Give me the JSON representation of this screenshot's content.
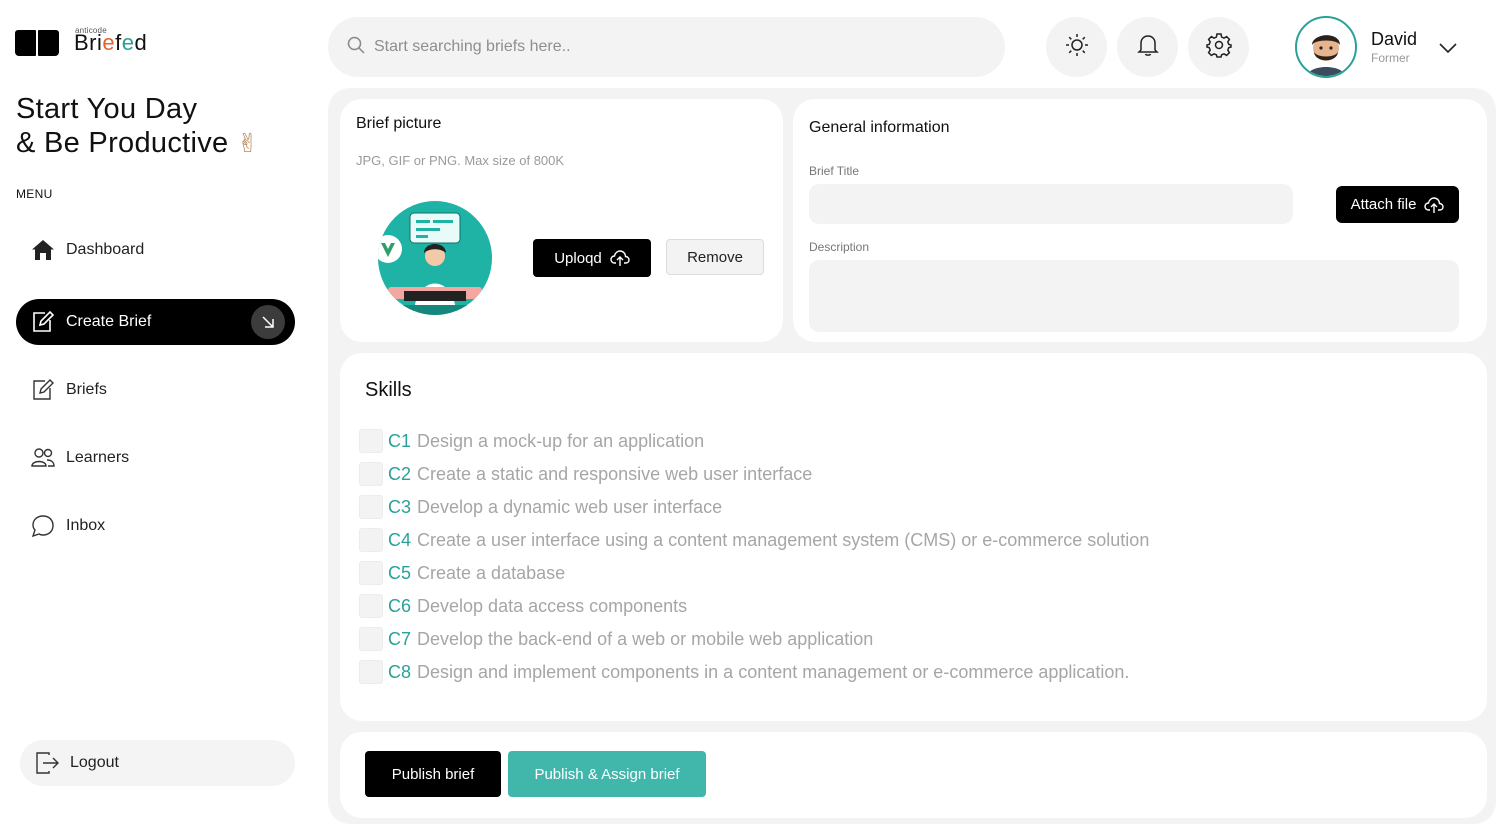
{
  "brand": {
    "small_text": "anticode",
    "name_parts": [
      "Bri",
      "e",
      "f",
      "e",
      "d"
    ]
  },
  "greeting": {
    "line1": "Start You Day",
    "line2": "& Be Productive",
    "emoji": "✌"
  },
  "menu": {
    "label": "MENU",
    "items": [
      {
        "label": "Dashboard",
        "icon": "home-icon"
      },
      {
        "label": "Create Brief",
        "icon": "edit-icon",
        "active": true
      },
      {
        "label": "Briefs",
        "icon": "edit-icon"
      },
      {
        "label": "Learners",
        "icon": "users-icon"
      },
      {
        "label": "Inbox",
        "icon": "chat-icon"
      }
    ],
    "logout": "Logout"
  },
  "search": {
    "placeholder": "Start searching briefs here.."
  },
  "user": {
    "name": "David",
    "role": "Former"
  },
  "brief_picture": {
    "title": "Brief picture",
    "hint": "JPG, GIF or PNG. Max size of 800K",
    "upload_label": "Uploqd",
    "remove_label": "Remove"
  },
  "general": {
    "title": "General information",
    "brief_title_label": "Brief Title",
    "attach_label": "Attach file",
    "description_label": "Description"
  },
  "skills": {
    "title": "Skills",
    "items": [
      {
        "code": "C1",
        "text": "Design a mock-up for an application"
      },
      {
        "code": "C2",
        "text": "Create a static and responsive web user interface"
      },
      {
        "code": "C3",
        "text": "Develop a dynamic web user interface"
      },
      {
        "code": "C4",
        "text": "Create a user interface using a content management system (CMS) or e-commerce solution"
      },
      {
        "code": "C5",
        "text": "Create a database"
      },
      {
        "code": "C6",
        "text": "Develop data access components"
      },
      {
        "code": "C7",
        "text": "Develop the back-end of a web or mobile web application"
      },
      {
        "code": "C8",
        "text": "Design and implement components in a content management or e-commerce application."
      }
    ]
  },
  "actions": {
    "publish": "Publish brief",
    "publish_assign": "Publish & Assign brief"
  },
  "colors": {
    "accent": "#2aa198",
    "teal_button": "#41b6ab",
    "logo_orange": "#e8622c"
  }
}
